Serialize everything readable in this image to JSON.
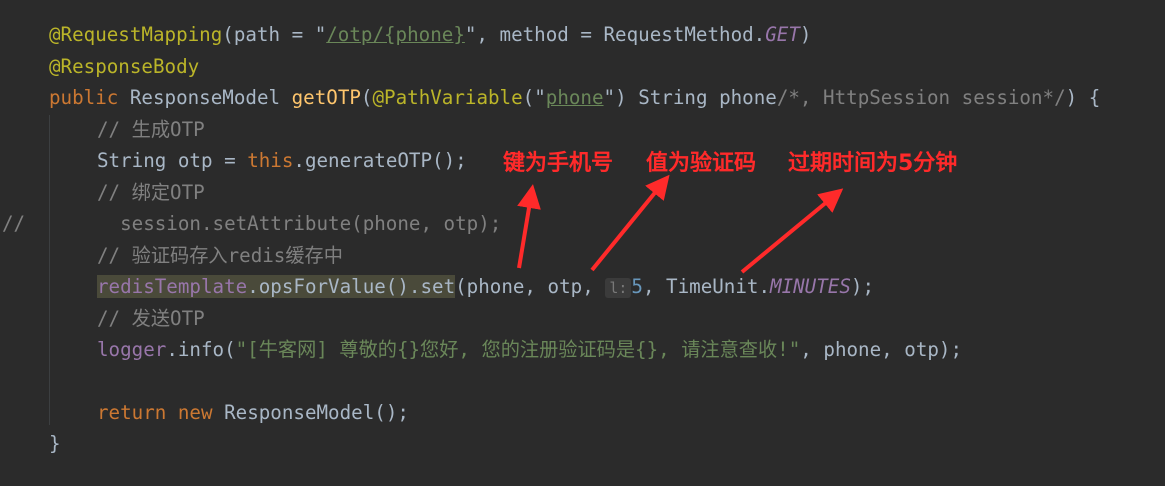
{
  "code": {
    "l1": {
      "ann": "@RequestMapping",
      "p1": "(path = \"",
      "path": "/otp/{phone}",
      "p2": "\", method = RequestMethod.",
      "get": "GET",
      "p3": ")"
    },
    "l2": {
      "ann": "@ResponseBody"
    },
    "l3": {
      "kw": "public ",
      "type": "ResponseModel ",
      "fn": "getOTP",
      "p1": "(",
      "ann": "@PathVariable",
      "p2": "(\"",
      "name": "phone",
      "p3": "\") String phone",
      "cmt": "/*, HttpSession session*/",
      "p4": ") {"
    },
    "l4": {
      "cmt": "// 生成OTP"
    },
    "l5": {
      "p1": "String otp = ",
      "kw": "this",
      "p2": ".generateOTP();"
    },
    "l6": {
      "cmt": "// 绑定OTP"
    },
    "l7": {
      "gutter": "//",
      "text": "  session.setAttribute(phone, otp);"
    },
    "l8": {
      "cmt": "// 验证码存入redis缓存中"
    },
    "l9": {
      "field": "redisTemplate",
      "p1": ".opsForValue().set",
      "p2": "(phone, otp, ",
      "hint": "l:",
      "num": "5",
      "p3": ", TimeUnit.",
      "unit": "MINUTES",
      "p4": ");"
    },
    "l10": {
      "cmt": "// 发送OTP"
    },
    "l11": {
      "field": "logger",
      "p1": ".info(",
      "str": "\"[牛客网] 尊敬的{}您好, 您的注册验证码是{}, 请注意查收!\"",
      "p2": ", phone, otp);"
    },
    "l13": {
      "kw1": "return ",
      "kw2": "new ",
      "p1": "ResponseModel();"
    },
    "l14": {
      "text": "}"
    }
  },
  "annotations": {
    "key": "键为手机号",
    "value": "值为验证码",
    "expire": "过期时间为5分钟",
    "color": "#ff2a2a"
  }
}
